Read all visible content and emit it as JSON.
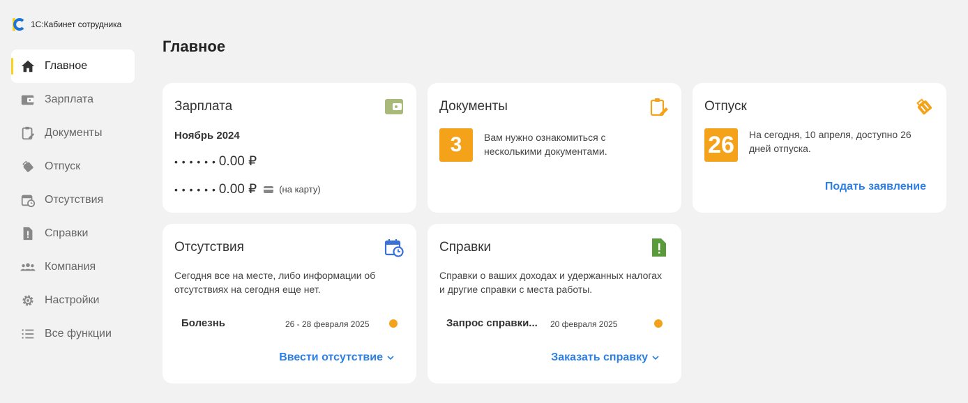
{
  "app": {
    "title": "1С:Кабинет сотрудника"
  },
  "sidebar": {
    "items": [
      {
        "label": "Главное",
        "icon": "home-icon"
      },
      {
        "label": "Зарплата",
        "icon": "wallet-icon"
      },
      {
        "label": "Документы",
        "icon": "clipboard-icon"
      },
      {
        "label": "Отпуск",
        "icon": "suitcase-icon"
      },
      {
        "label": "Отсутствия",
        "icon": "calendar-clock-icon"
      },
      {
        "label": "Справки",
        "icon": "document-alert-icon"
      },
      {
        "label": "Компания",
        "icon": "people-icon"
      },
      {
        "label": "Настройки",
        "icon": "gear-icon"
      },
      {
        "label": "Все функции",
        "icon": "list-icon"
      }
    ],
    "active": "Главное"
  },
  "page": {
    "title": "Главное"
  },
  "salary": {
    "title": "Зарплата",
    "period": "Ноябрь 2024",
    "masked_prefix": "• • •  • • •",
    "amount1": "0.00 ₽",
    "amount2": "0.00 ₽",
    "card_note": "(на карту)"
  },
  "documents": {
    "title": "Документы",
    "count": "3",
    "text": "Вам нужно ознакомиться с несколькими документами."
  },
  "vacation": {
    "title": "Отпуск",
    "days": "26",
    "text": "На сегодня, 10 апреля, доступно 26 дней отпуска.",
    "link": "Подать заявление"
  },
  "absences": {
    "title": "Отсутствия",
    "text": "Сегодня все на месте, либо информации об отсутствиях на сегодня еще нет.",
    "item": {
      "name": "Болезнь",
      "date": "26 - 28 февраля 2025"
    },
    "link": "Ввести отсутствие"
  },
  "certificates": {
    "title": "Справки",
    "text": "Справки о ваших доходах и удержанных налогах и другие справки с места работы.",
    "item": {
      "name": "Запрос справки...",
      "date": "20 февраля 2025"
    },
    "link": "Заказать справку"
  },
  "colors": {
    "accent": "#f8d21c",
    "badge": "#f5a21b",
    "link": "#2d7fe3",
    "salary_icon": "#a8b97a",
    "cert_icon": "#5b9a3a",
    "abs_icon": "#3a6fd8"
  }
}
